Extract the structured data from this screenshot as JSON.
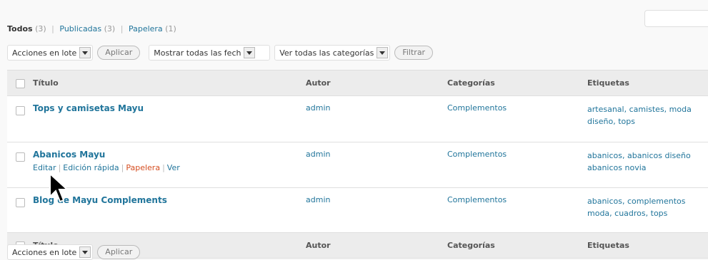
{
  "filters": {
    "all_label": "Todos",
    "all_count": "(3)",
    "published_label": "Publicadas",
    "published_count": "(3)",
    "trash_label": "Papelera",
    "trash_count": "(1)",
    "separator": "|"
  },
  "top_nav": {
    "bulk_actions": "Acciones en lote",
    "apply": "Aplicar",
    "dates": "Mostrar todas las fech",
    "categories": "Ver todas las categorías",
    "filter": "Filtrar"
  },
  "columns": {
    "title": "Título",
    "author": "Autor",
    "categories": "Categorías",
    "tags": "Etiquetas"
  },
  "rows": [
    {
      "title": "Tops y camisetas Mayu",
      "author": "admin",
      "category": "Complementos",
      "tags_line1": "artesanal, camistes, moda",
      "tags_line2": "diseño, tops"
    },
    {
      "title": "Abanicos Mayu",
      "author": "admin",
      "category": "Complementos",
      "tags_line1": "abanicos, abanicos diseño",
      "tags_line2": "abanicos novia"
    },
    {
      "title": "Blog de Mayu Complements",
      "author": "admin",
      "category": "Complementos",
      "tags_line1": "abanicos, complementos",
      "tags_line2": "moda, cuadros, tops"
    }
  ],
  "row_actions": {
    "edit": "Editar",
    "quick_edit": "Edición rápida",
    "trash": "Papelera",
    "view": "Ver"
  },
  "bottom_nav": {
    "bulk_actions": "Acciones en lote",
    "apply": "Aplicar"
  }
}
